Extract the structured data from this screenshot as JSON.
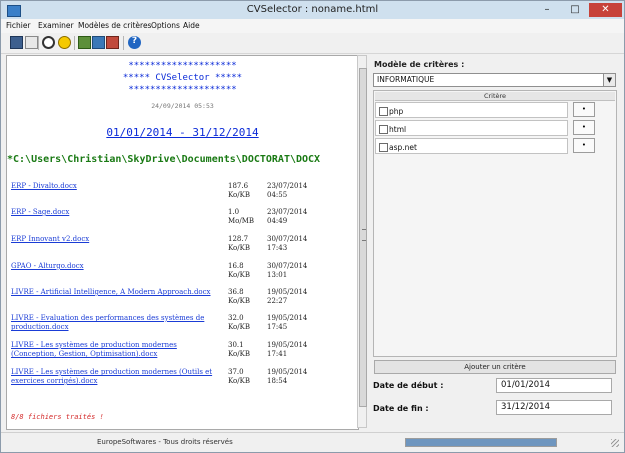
{
  "window": {
    "title": "CVSelector : noname.html",
    "minimize_glyph": "–",
    "maximize_glyph": "□",
    "close_glyph": "✕"
  },
  "menu": [
    "Fichier",
    "Examiner",
    "Modèles de critères",
    "Options",
    "Aide"
  ],
  "toolbar": {
    "icons": [
      "save-icon",
      "print-icon",
      "stop-icon",
      "warning-icon",
      "grid-green-icon",
      "grid-blue-icon",
      "grid-red-icon",
      "help-icon"
    ],
    "help_glyph": "?"
  },
  "report": {
    "stars": "********************",
    "app_line": "***** CVSelector *****",
    "generated": "24/09/2014 05:53",
    "date_range": "01/01/2014 - 31/12/2014",
    "path": "*C:\\Users\\Christian\\SkyDrive\\Documents\\DOCTORAT\\DOCX",
    "files": [
      {
        "name": "ERP - Divalto.docx",
        "size": "187.6",
        "unit": "Ko/KB",
        "date": "23/07/2014",
        "time": "04:55"
      },
      {
        "name": "ERP - Sage.docx",
        "size": "1.0",
        "unit": "Mo/MB",
        "date": "23/07/2014",
        "time": "04:49"
      },
      {
        "name": "ERP Innovant v2.docx",
        "size": "128.7",
        "unit": "Ko/KB",
        "date": "30/07/2014",
        "time": "17:43"
      },
      {
        "name": "GPAO - Alturgo.docx",
        "size": "16.8",
        "unit": "Ko/KB",
        "date": "30/07/2014",
        "time": "13:01"
      },
      {
        "name": "LIVRE - Artificial Intelligence, A Modern Approach.docx",
        "size": "36.8",
        "unit": "Ko/KB",
        "date": "19/05/2014",
        "time": "22:27"
      },
      {
        "name": "LIVRE - Evaluation des performances des systèmes de production.docx",
        "size": "32.0",
        "unit": "Ko/KB",
        "date": "19/05/2014",
        "time": "17:45"
      },
      {
        "name": "LIVRE - Les systèmes de production modernes (Conception, Gestion, Optimisation).docx",
        "size": "30.1",
        "unit": "Ko/KB",
        "date": "19/05/2014",
        "time": "17:41"
      },
      {
        "name": "LIVRE - Les systèmes de production modernes (Outils et exercices corrigés).docx",
        "size": "37.0",
        "unit": "Ko/KB",
        "date": "19/05/2014",
        "time": "18:54"
      }
    ],
    "summary": "8/8 fichiers traités !"
  },
  "criteria": {
    "label": "Modèle de critères :",
    "model": "INFORMATIQUE",
    "column_header": "Critère",
    "items": [
      {
        "label": "php",
        "checked": false
      },
      {
        "label": "html",
        "checked": false
      },
      {
        "label": "asp.net",
        "checked": false
      }
    ],
    "item_button": "•",
    "add_button": "Ajouter un critère",
    "start_label": "Date de début :",
    "start_value": "01/01/2014",
    "end_label": "Date de fin :",
    "end_value": "31/12/2014"
  },
  "status": {
    "text": "EuropeSoftwares - Tous droits réservés",
    "progress": 1.0
  },
  "colors": {
    "link": "#1a3cd6",
    "path": "#1a7a14",
    "summary": "#d42a2a",
    "stars": "#0b2bd8",
    "titlebar": "#cfe0ee"
  }
}
